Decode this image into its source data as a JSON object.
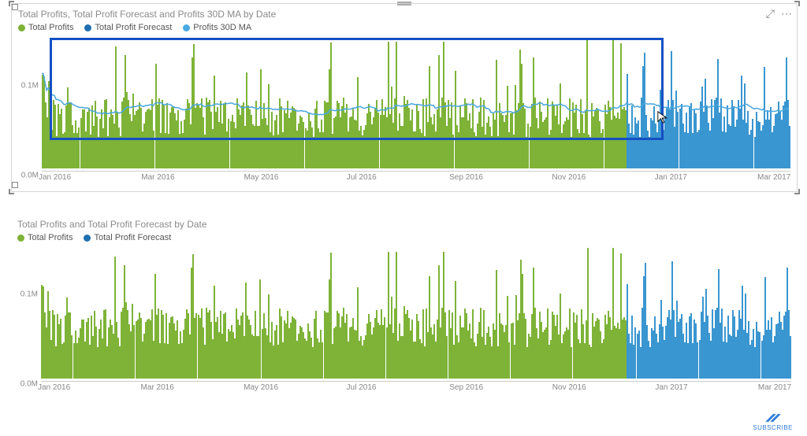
{
  "colors": {
    "profits": "#7eb338",
    "forecast": "#3a96d0",
    "ma": "#4aa8e0",
    "highlight": "#1450c4"
  },
  "chart1": {
    "title": "Total Profits, Total Profit Forecast and Profits 30D MA by Date",
    "legend": [
      {
        "label": "Total Profits",
        "color": "#7eb338"
      },
      {
        "label": "Total Profit Forecast",
        "color": "#1f6fb0"
      },
      {
        "label": "Profits 30D MA",
        "color": "#4aa8e0"
      }
    ],
    "y_ticks": [
      {
        "label": "0.1M",
        "value": 100000
      },
      {
        "label": "0.0M",
        "value": 0
      }
    ],
    "x_ticks": [
      "Jan 2016",
      "Mar 2016",
      "May 2016",
      "Jul 2016",
      "Sep 2016",
      "Nov 2016",
      "Jan 2017",
      "Mar 2017"
    ],
    "y_max": 150000,
    "ma_approx": 60000,
    "highlight": {
      "x0_frac": 0.01,
      "x1_frac": 0.83,
      "y_top_frac": 0.02,
      "y_bot_frac": 0.78
    },
    "header_icons": {
      "focus": "⤢",
      "more": "⋯"
    }
  },
  "chart2": {
    "title": "Total Profits and Total Profit Forecast by Date",
    "legend": [
      {
        "label": "Total Profits",
        "color": "#7eb338"
      },
      {
        "label": "Total Profit Forecast",
        "color": "#1f6fb0"
      }
    ],
    "y_ticks": [
      {
        "label": "0.1M",
        "value": 100000
      },
      {
        "label": "0.0M",
        "value": 0
      }
    ],
    "x_ticks": [
      "Jan 2016",
      "Mar 2016",
      "May 2016",
      "Jul 2016",
      "Sep 2016",
      "Nov 2016",
      "Jan 2017",
      "Mar 2017"
    ],
    "y_max": 150000
  },
  "subscribe_label": "SUBSCRIBE",
  "chart_data": [
    {
      "type": "bar+line",
      "title": "Total Profits, Total Profit Forecast and Profits 30D MA by Date",
      "xlabel": "Date",
      "ylabel": "",
      "ylim": [
        0,
        150000
      ],
      "x_range": [
        "2016-01-01",
        "2017-04-15"
      ],
      "x_tick_labels": [
        "Jan 2016",
        "Mar 2016",
        "May 2016",
        "Jul 2016",
        "Sep 2016",
        "Nov 2016",
        "Jan 2017",
        "Mar 2017"
      ],
      "y_tick_labels": [
        "0.0M",
        "0.1M"
      ],
      "series": [
        {
          "name": "Total Profits",
          "type": "bar",
          "color": "#7eb338",
          "note": "Daily bars Jan 2016 – Dec 2016, roughly 20k–130k, typical ~55k",
          "sample_values": [
            45000,
            72000,
            38000,
            61000,
            110000,
            33000,
            58000,
            92000,
            47000,
            66000,
            120000,
            41000
          ]
        },
        {
          "name": "Total Profit Forecast",
          "type": "bar",
          "color": "#3a96d0",
          "note": "Daily bars Jan 2017 – Apr 2017, roughly 20k–120k, typical ~55k",
          "sample_values": [
            52000,
            68000,
            39000,
            71000,
            95000,
            44000,
            60000,
            83000,
            49000,
            62000,
            108000,
            37000
          ]
        },
        {
          "name": "Profits 30D MA",
          "type": "line",
          "color": "#4aa8e0",
          "note": "30-day moving average, hovers ~55k–70k with mild undulation",
          "sample_values": [
            58000,
            60000,
            62000,
            59000,
            61000,
            63000,
            60000,
            58000,
            62000,
            65000,
            63000,
            60000,
            61000,
            64000,
            62000
          ]
        }
      ]
    },
    {
      "type": "bar",
      "title": "Total Profits and Total Profit Forecast by Date",
      "xlabel": "Date",
      "ylabel": "",
      "ylim": [
        0,
        150000
      ],
      "x_range": [
        "2016-01-01",
        "2017-04-15"
      ],
      "x_tick_labels": [
        "Jan 2016",
        "Mar 2016",
        "May 2016",
        "Jul 2016",
        "Sep 2016",
        "Nov 2016",
        "Jan 2017",
        "Mar 2017"
      ],
      "y_tick_labels": [
        "0.0M",
        "0.1M"
      ],
      "series": [
        {
          "name": "Total Profits",
          "type": "bar",
          "color": "#7eb338",
          "note": "Daily bars Jan 2016 – Dec 2016, roughly 20k–130k, typical ~55k",
          "sample_values": [
            45000,
            72000,
            38000,
            61000,
            110000,
            33000,
            58000,
            92000,
            47000,
            66000,
            120000,
            41000
          ]
        },
        {
          "name": "Total Profit Forecast",
          "type": "bar",
          "color": "#3a96d0",
          "note": "Daily bars Jan 2017 – Apr 2017, roughly 20k–120k, typical ~55k",
          "sample_values": [
            52000,
            68000,
            39000,
            71000,
            95000,
            44000,
            60000,
            83000,
            49000,
            62000,
            108000,
            37000
          ]
        }
      ]
    }
  ]
}
